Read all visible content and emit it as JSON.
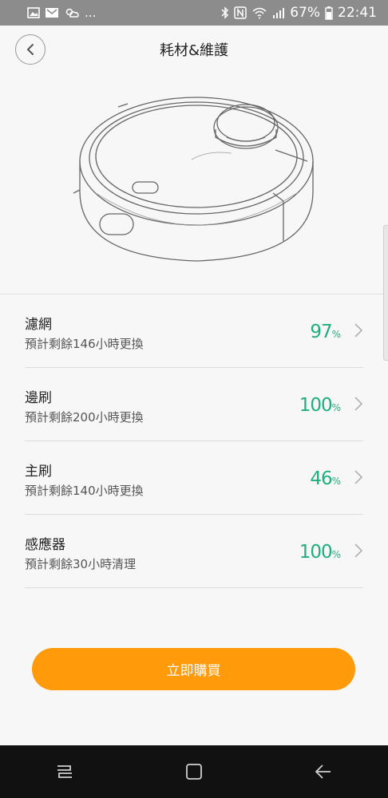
{
  "status_bar": {
    "dots": "...",
    "battery": "67%",
    "time": "22:41"
  },
  "header": {
    "title": "耗材&維護"
  },
  "items": [
    {
      "name": "濾網",
      "desc": "預計剩餘146小時更換",
      "percent": "97",
      "unit": "%"
    },
    {
      "name": "邊刷",
      "desc": "預計剩餘200小時更換",
      "percent": "100",
      "unit": "%"
    },
    {
      "name": "主刷",
      "desc": "預計剩餘140小時更換",
      "percent": "46",
      "unit": "%"
    },
    {
      "name": "感應器",
      "desc": "預計剩餘30小時清理",
      "percent": "100",
      "unit": "%"
    }
  ],
  "buy_button": {
    "label": "立即購買"
  },
  "colors": {
    "accent": "#ff9a0a",
    "percent": "#1eae7f"
  }
}
